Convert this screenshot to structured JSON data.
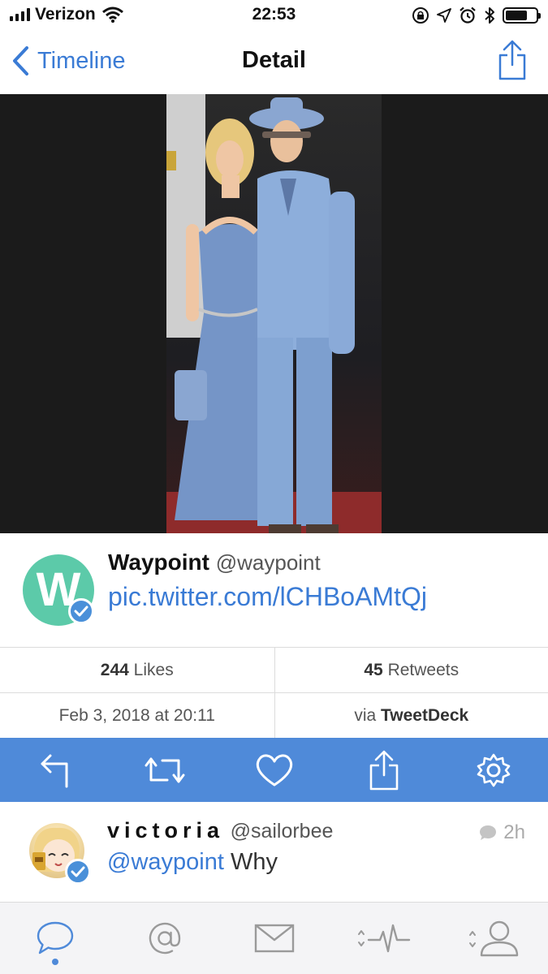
{
  "status_bar": {
    "carrier": "Verizon",
    "time": "22:53"
  },
  "nav": {
    "back_label": "Timeline",
    "title": "Detail"
  },
  "tweet": {
    "avatar_letter": "W",
    "author_name": "Waypoint",
    "author_handle": "@waypoint",
    "link": "pic.twitter.com/lCHBoAMtQj",
    "verified": true
  },
  "stats": {
    "likes_count": "244",
    "likes_label": "Likes",
    "retweets_count": "45",
    "retweets_label": "Retweets",
    "timestamp": "Feb 3, 2018 at 20:11",
    "via_label": "via",
    "client": "TweetDeck"
  },
  "actions": [
    "reply-icon",
    "retweet-icon",
    "like-icon",
    "share-icon",
    "settings-icon"
  ],
  "reply": {
    "author_name": "victoria",
    "author_handle": "@sailorbee",
    "age": "2h",
    "mention": "@waypoint",
    "text": "Why",
    "verified": true
  },
  "tabs": [
    "timeline-tab",
    "mentions-tab",
    "messages-tab",
    "activity-tab",
    "profile-tab"
  ],
  "colors": {
    "accent": "#4f8ad9",
    "link": "#3a7bd5",
    "avatar_bg": "#5ccaa9"
  }
}
